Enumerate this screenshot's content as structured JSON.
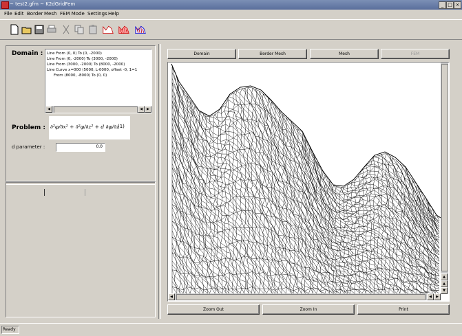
{
  "window": {
    "title": "~ test2.gfm ~ K2dGridFem",
    "btn_min": "_",
    "btn_max": "□",
    "btn_close": "×"
  },
  "menu": [
    "File",
    "Edit",
    "Border",
    "Mesh",
    "FEM Mode",
    "Settings",
    "Help"
  ],
  "domain": {
    "label": "Domain :",
    "lines": [
      "Line From (0, 0) To (0, -2000)",
      "Line From (0, -2000) To (3000, -2000)",
      "Line From (3000, -2000) To (8000, -2000)",
      "Line Curve x=000 (5000, L-0000, offset -0, 1=1",
      "From (8000, -8000) To (0, 0)"
    ]
  },
  "problem": {
    "label": "Problem :",
    "formula": "∂²φ/∂x² + ∂²φ/∂z² + d ∂φ/∂z",
    "rhs": "(1)"
  },
  "param": {
    "label": "d parameter :",
    "value": "0.0"
  },
  "buttons": {
    "domain": "Domain",
    "border_mesh": "Border Mesh",
    "mesh": "Mesh",
    "fem": "FEM",
    "zoom_out": "Zoom Out",
    "zoom_in": "Zoom In",
    "print": "Print"
  },
  "status": {
    "text": "Ready"
  },
  "colors": {
    "titlebar": "#6a7fae",
    "panel": "#d4d0c8",
    "canvas": "#ffffff",
    "mesh": "#000000"
  }
}
